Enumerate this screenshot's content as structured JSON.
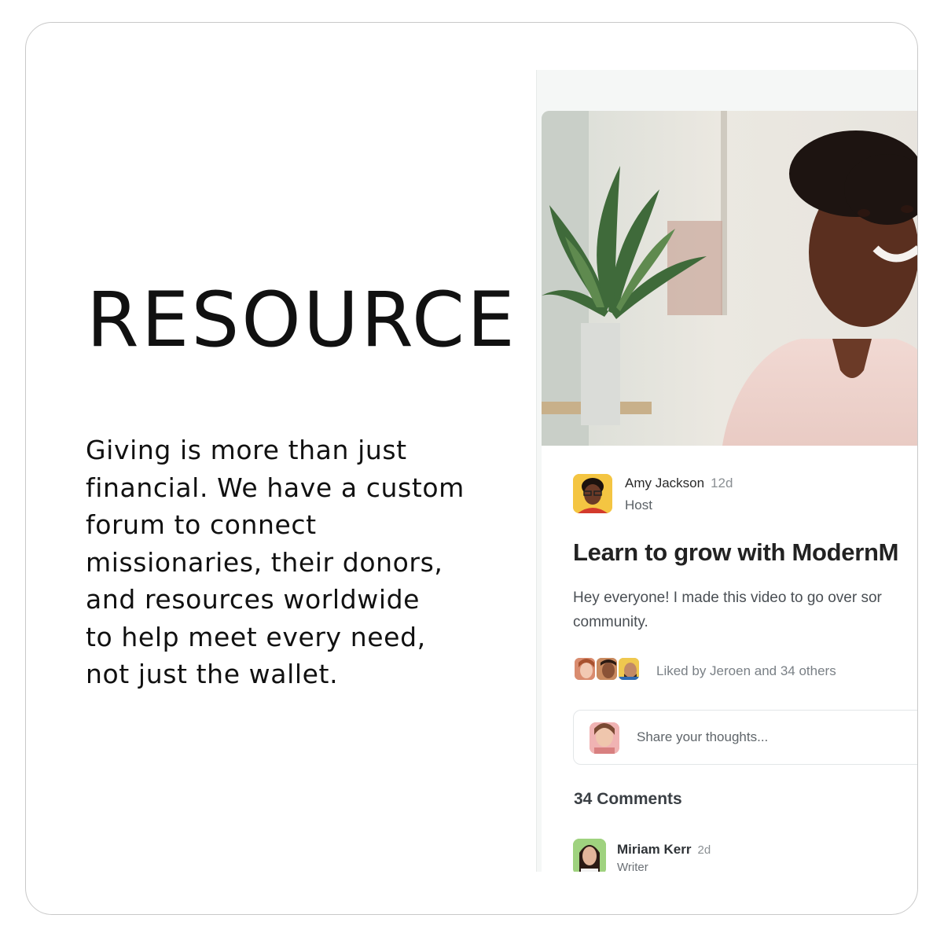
{
  "heading": "RESOURCE",
  "description_lines": [
    "Giving is more than just",
    "financial. We have a custom",
    "forum to connect",
    "missionaries, their donors,",
    "and resources worldwide",
    "to help meet every need,",
    "not just the wallet."
  ],
  "post": {
    "author": {
      "name": "Amy Jackson",
      "time": "12d",
      "role": "Host"
    },
    "title": "Learn to grow with ModernM",
    "text_lines": [
      "Hey everyone! I made this video to go over sor",
      "community."
    ],
    "liked_by": "Liked by Jeroen and 34 others",
    "comment_placeholder": "Share your thoughts...",
    "comments_count": "34 Comments",
    "first_comment": {
      "name": "Miriam Kerr",
      "time": "2d",
      "role": "Writer"
    }
  },
  "colors": {
    "accent_avatar_bg": "#f4c542",
    "text_primary": "#222222",
    "text_muted": "#7a8086",
    "panel_bg": "#f5f7f6"
  },
  "icons": [
    "video-thumbnail-image",
    "author-avatar",
    "liker-avatars",
    "user-avatar",
    "commenter-avatar"
  ]
}
